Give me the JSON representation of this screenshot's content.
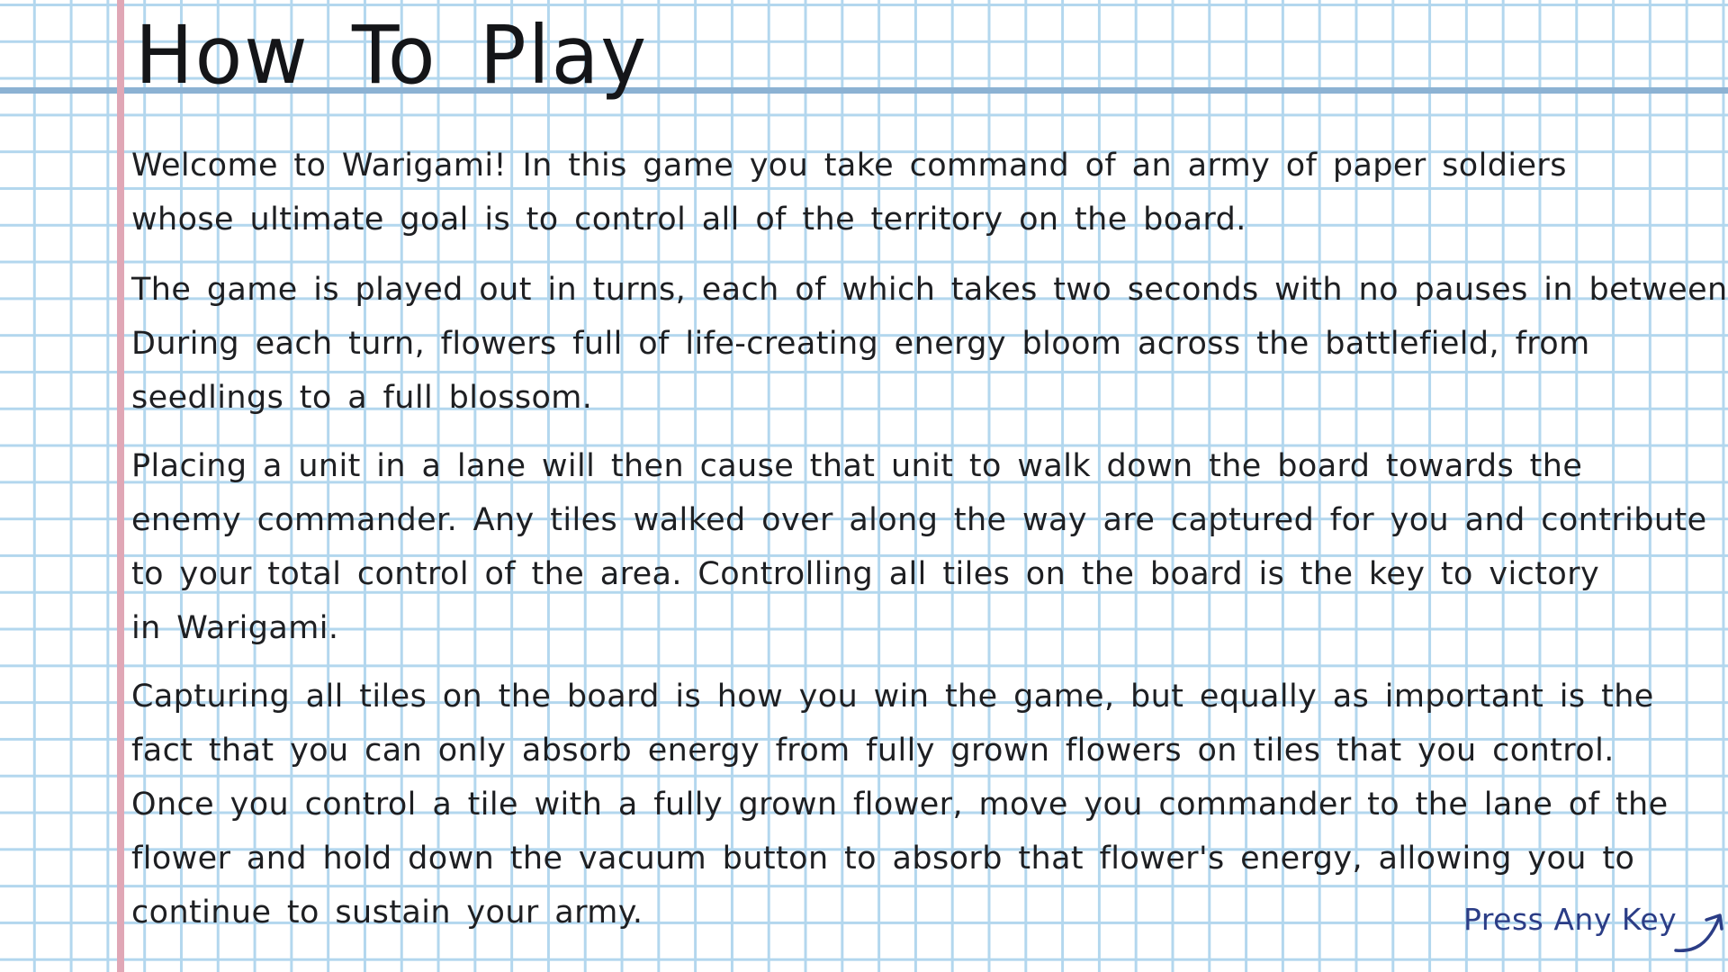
{
  "screen": {
    "title": "How To Play",
    "paragraphs": [
      {
        "lines": [
          "Welcome to Warigami! In this game you take command of an army of paper soldiers",
          "whose ultimate goal is to control all of the territory on the board."
        ]
      },
      {
        "lines": [
          "The game is played out in turns, each of which takes two seconds with no pauses in between.",
          "During each turn, flowers full of life-creating energy bloom across the battlefield, from",
          "seedlings to a full blossom."
        ]
      },
      {
        "lines": [
          "Placing a unit in a lane will then cause that unit to walk down the board towards the",
          "enemy commander. Any tiles walked over along the way are captured for you and contribute",
          "to your total control of the area. Controlling all tiles on the board is the key to victory",
          "in Warigami."
        ]
      },
      {
        "lines": [
          "Capturing all tiles on the board is how you win the game, but equally as important is the",
          "fact that you can only absorb energy from fully grown flowers on tiles that you control.",
          "Once you control a tile with a fully grown flower, move you commander to the lane of the",
          "flower and hold down the vacuum button to absorb that flower's energy, allowing you to",
          "continue to sustain your army."
        ]
      }
    ],
    "press_key": {
      "label": "Press Any Key",
      "icon": "curved-arrow-icon"
    }
  },
  "colors": {
    "grid_line": "#b3d7ee",
    "header_rule": "#8cb2d3",
    "margin_line": "#e0a7b6",
    "text": "#1e1f22",
    "press_key": "#2b3d86"
  }
}
